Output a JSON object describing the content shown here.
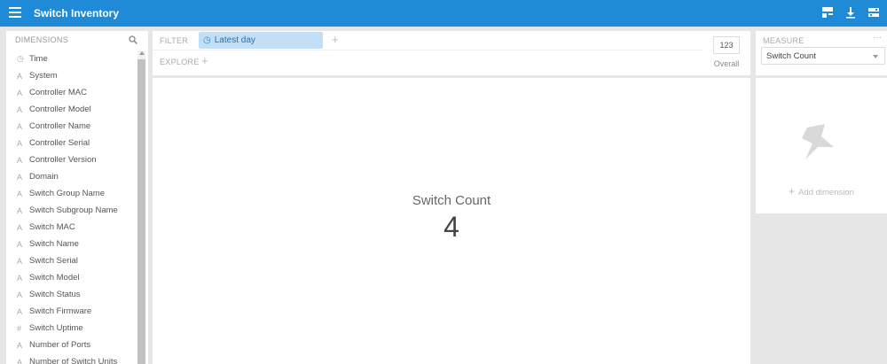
{
  "app": {
    "title": "Switch Inventory",
    "accent_color": "#1f8ad6",
    "icons": [
      "menu-icon",
      "layout-icon",
      "download-icon",
      "settings-icon"
    ]
  },
  "dimensions": {
    "header": "DIMENSIONS",
    "items": [
      {
        "icon": "time-icon",
        "glyph": "◷",
        "label": "Time"
      },
      {
        "icon": "string-icon",
        "glyph": "A",
        "label": "System"
      },
      {
        "icon": "string-icon",
        "glyph": "A",
        "label": "Controller MAC"
      },
      {
        "icon": "string-icon",
        "glyph": "A",
        "label": "Controller Model"
      },
      {
        "icon": "string-icon",
        "glyph": "A",
        "label": "Controller Name"
      },
      {
        "icon": "string-icon",
        "glyph": "A",
        "label": "Controller Serial"
      },
      {
        "icon": "string-icon",
        "glyph": "A",
        "label": "Controller Version"
      },
      {
        "icon": "string-icon",
        "glyph": "A",
        "label": "Domain"
      },
      {
        "icon": "string-icon",
        "glyph": "A",
        "label": "Switch Group Name"
      },
      {
        "icon": "string-icon",
        "glyph": "A",
        "label": "Switch Subgroup Name"
      },
      {
        "icon": "string-icon",
        "glyph": "A",
        "label": "Switch MAC"
      },
      {
        "icon": "string-icon",
        "glyph": "A",
        "label": "Switch Name"
      },
      {
        "icon": "string-icon",
        "glyph": "A",
        "label": "Switch Serial"
      },
      {
        "icon": "string-icon",
        "glyph": "A",
        "label": "Switch Model"
      },
      {
        "icon": "string-icon",
        "glyph": "A",
        "label": "Switch Status"
      },
      {
        "icon": "string-icon",
        "glyph": "A",
        "label": "Switch Firmware"
      },
      {
        "icon": "number-icon",
        "glyph": "#",
        "label": "Switch Uptime"
      },
      {
        "icon": "string-icon",
        "glyph": "A",
        "label": "Number of Ports"
      },
      {
        "icon": "string-icon",
        "glyph": "A",
        "label": "Number of Switch Units"
      }
    ]
  },
  "filter": {
    "label": "FILTER",
    "pill": "Latest day",
    "add": "+"
  },
  "explore": {
    "label": "EXPLORE",
    "add": "+"
  },
  "overall": {
    "value": "123",
    "label": "Overall"
  },
  "main": {
    "measure_title": "Switch Count",
    "measure_value": "4"
  },
  "measure_panel": {
    "label": "MEASURE",
    "more": "···",
    "selected": "Switch Count"
  },
  "pin_panel": {
    "add_label": "Add dimension",
    "add_plus": "+"
  }
}
